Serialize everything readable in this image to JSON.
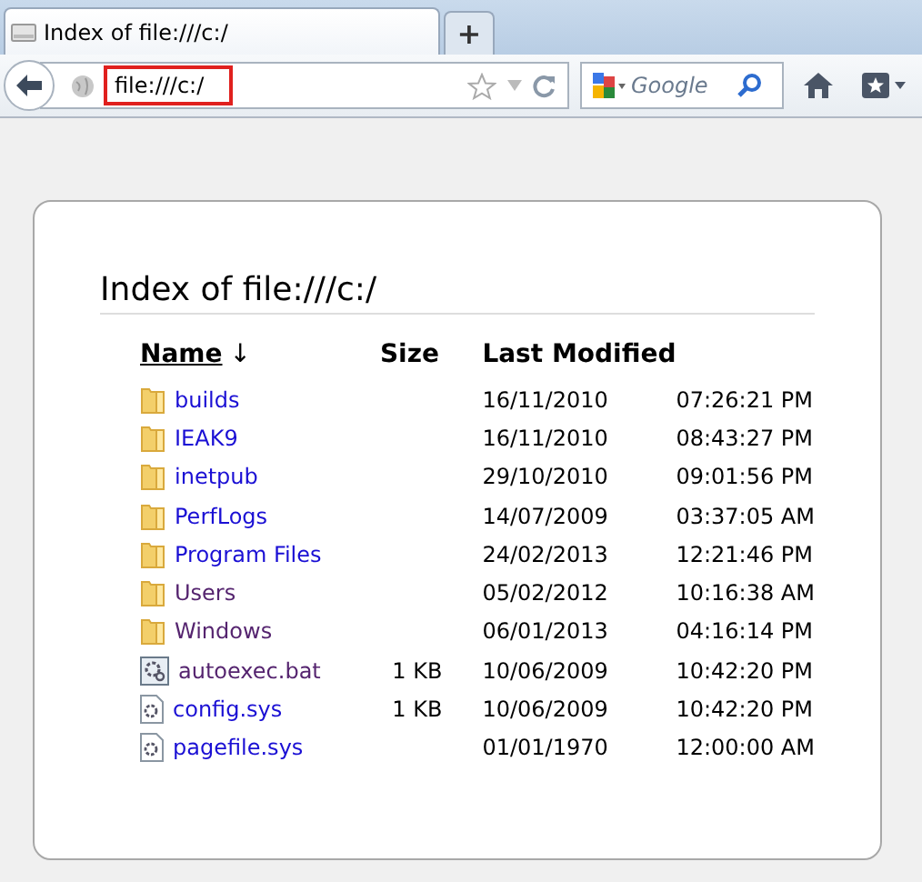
{
  "tab": {
    "title": "Index of file:///c:/",
    "new_tab": "+"
  },
  "toolbar": {
    "address": "file:///c:/",
    "search_placeholder": "Google"
  },
  "page": {
    "heading": "Index of file:///c:/",
    "columns": [
      {
        "label": "Name",
        "sort": "↓"
      },
      {
        "label": "Size"
      },
      {
        "label": "Last Modified"
      }
    ],
    "rows": [
      {
        "kind": "folder",
        "name": "builds",
        "visited": false,
        "size": "",
        "date": "16/11/2010",
        "time": "07:26:21 PM"
      },
      {
        "kind": "folder",
        "name": "IEAK9",
        "visited": false,
        "size": "",
        "date": "16/11/2010",
        "time": "08:43:27 PM"
      },
      {
        "kind": "folder",
        "name": "inetpub",
        "visited": false,
        "size": "",
        "date": "29/10/2010",
        "time": "09:01:56 PM"
      },
      {
        "kind": "folder",
        "name": "PerfLogs",
        "visited": false,
        "size": "",
        "date": "14/07/2009",
        "time": "03:37:05 AM"
      },
      {
        "kind": "folder",
        "name": "Program Files",
        "visited": false,
        "size": "",
        "date": "24/02/2013",
        "time": "12:21:46 PM"
      },
      {
        "kind": "folder",
        "name": "Users",
        "visited": true,
        "size": "",
        "date": "05/02/2012",
        "time": "10:16:38 AM"
      },
      {
        "kind": "folder",
        "name": "Windows",
        "visited": true,
        "size": "",
        "date": "06/01/2013",
        "time": "04:16:14 PM"
      },
      {
        "kind": "batch",
        "name": "autoexec.bat",
        "visited": true,
        "size": "1 KB",
        "date": "10/06/2009",
        "time": "10:42:20 PM"
      },
      {
        "kind": "system",
        "name": "config.sys",
        "visited": false,
        "size": "1 KB",
        "date": "10/06/2009",
        "time": "10:42:20 PM"
      },
      {
        "kind": "system",
        "name": "pagefile.sys",
        "visited": false,
        "size": "",
        "date": "01/01/1970",
        "time": "12:00:00 AM"
      }
    ]
  }
}
